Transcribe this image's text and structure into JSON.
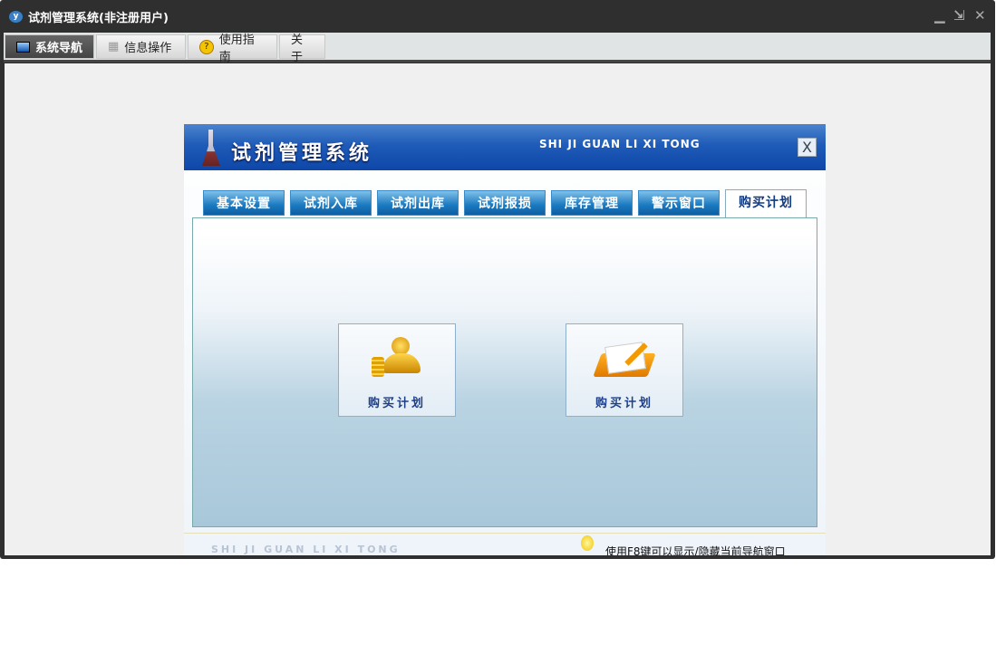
{
  "window": {
    "title": "试剂管理系统(非注册用户)",
    "minimize": "▁",
    "restore": "⇲",
    "close": "✕"
  },
  "top_tabs": [
    {
      "label": "系统导航",
      "icon": "monitor-icon"
    },
    {
      "label": "信息操作",
      "icon": "grid-icon"
    },
    {
      "label": "使用指南",
      "icon": "help-icon"
    },
    {
      "label": "关于"
    }
  ],
  "panel": {
    "title": "试剂管理系统",
    "subtitle": "SHI JI GUAN LI XI TONG",
    "close": "X",
    "tabs": [
      "基本设置",
      "试剂入库",
      "试剂出库",
      "试剂报损",
      "库存管理",
      "警示窗口",
      "购买计划"
    ],
    "active_tab": "购买计划",
    "buttons": [
      {
        "label": "购买计划",
        "icon": "user-coins-icon"
      },
      {
        "label": "购买计划",
        "icon": "notebook-pencil-icon"
      }
    ],
    "footer_sub": "SHI JI GUAN LI XI TONG",
    "footer_tip": "使用F8键可以显示/隐藏当前导航窗口"
  }
}
